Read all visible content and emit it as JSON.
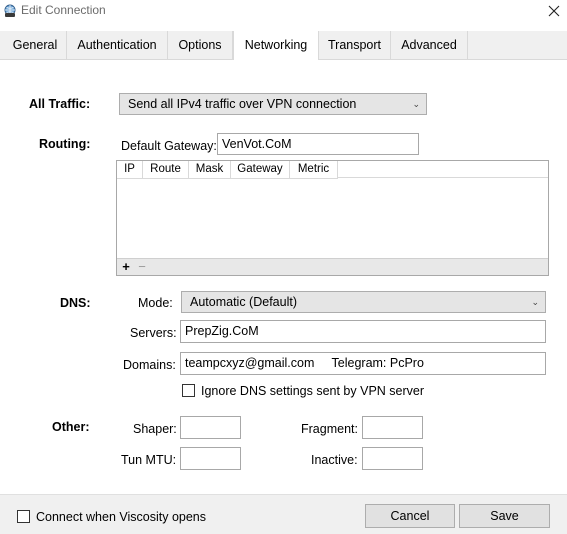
{
  "window": {
    "title": "Edit Connection",
    "close_glyph": "✕"
  },
  "tabs": [
    {
      "label": "General"
    },
    {
      "label": "Authentication"
    },
    {
      "label": "Options"
    },
    {
      "label": "Networking",
      "active": true
    },
    {
      "label": "Transport"
    },
    {
      "label": "Advanced"
    }
  ],
  "all_traffic": {
    "label": "All Traffic:",
    "value": "Send all IPv4 traffic over VPN connection"
  },
  "routing": {
    "label": "Routing:",
    "default_gateway_label": "Default Gateway:",
    "default_gateway_value": "VenVot.CoM",
    "columns": [
      "IP",
      "Route",
      "Mask",
      "Gateway",
      "Metric"
    ],
    "add_glyph": "+",
    "remove_glyph": "−"
  },
  "dns": {
    "label": "DNS:",
    "mode_label": "Mode:",
    "mode_value": "Automatic (Default)",
    "servers_label": "Servers:",
    "servers_value": "PrepZig.CoM",
    "domains_label": "Domains:",
    "domains_value": "teampcxyz@gmail.com     Telegram: PcPro",
    "ignore_label": "Ignore DNS settings sent by VPN server",
    "ignore_checked": false
  },
  "other": {
    "label": "Other:",
    "shaper_label": "Shaper:",
    "shaper_value": "",
    "fragment_label": "Fragment:",
    "fragment_value": "",
    "tunmtu_label": "Tun MTU:",
    "tunmtu_value": "",
    "inactive_label": "Inactive:",
    "inactive_value": ""
  },
  "footer": {
    "connect_label": "Connect when Viscosity opens",
    "connect_checked": false,
    "cancel_label": "Cancel",
    "save_label": "Save"
  },
  "icons": {
    "app": "viscosity-globe-icon",
    "dropdown": "chevron-down-icon",
    "close": "close-icon"
  },
  "colors": {
    "tab_bar": "#f0f0f0",
    "combo_bg": "#e5e5e5",
    "footer": "#f0f0f0"
  }
}
